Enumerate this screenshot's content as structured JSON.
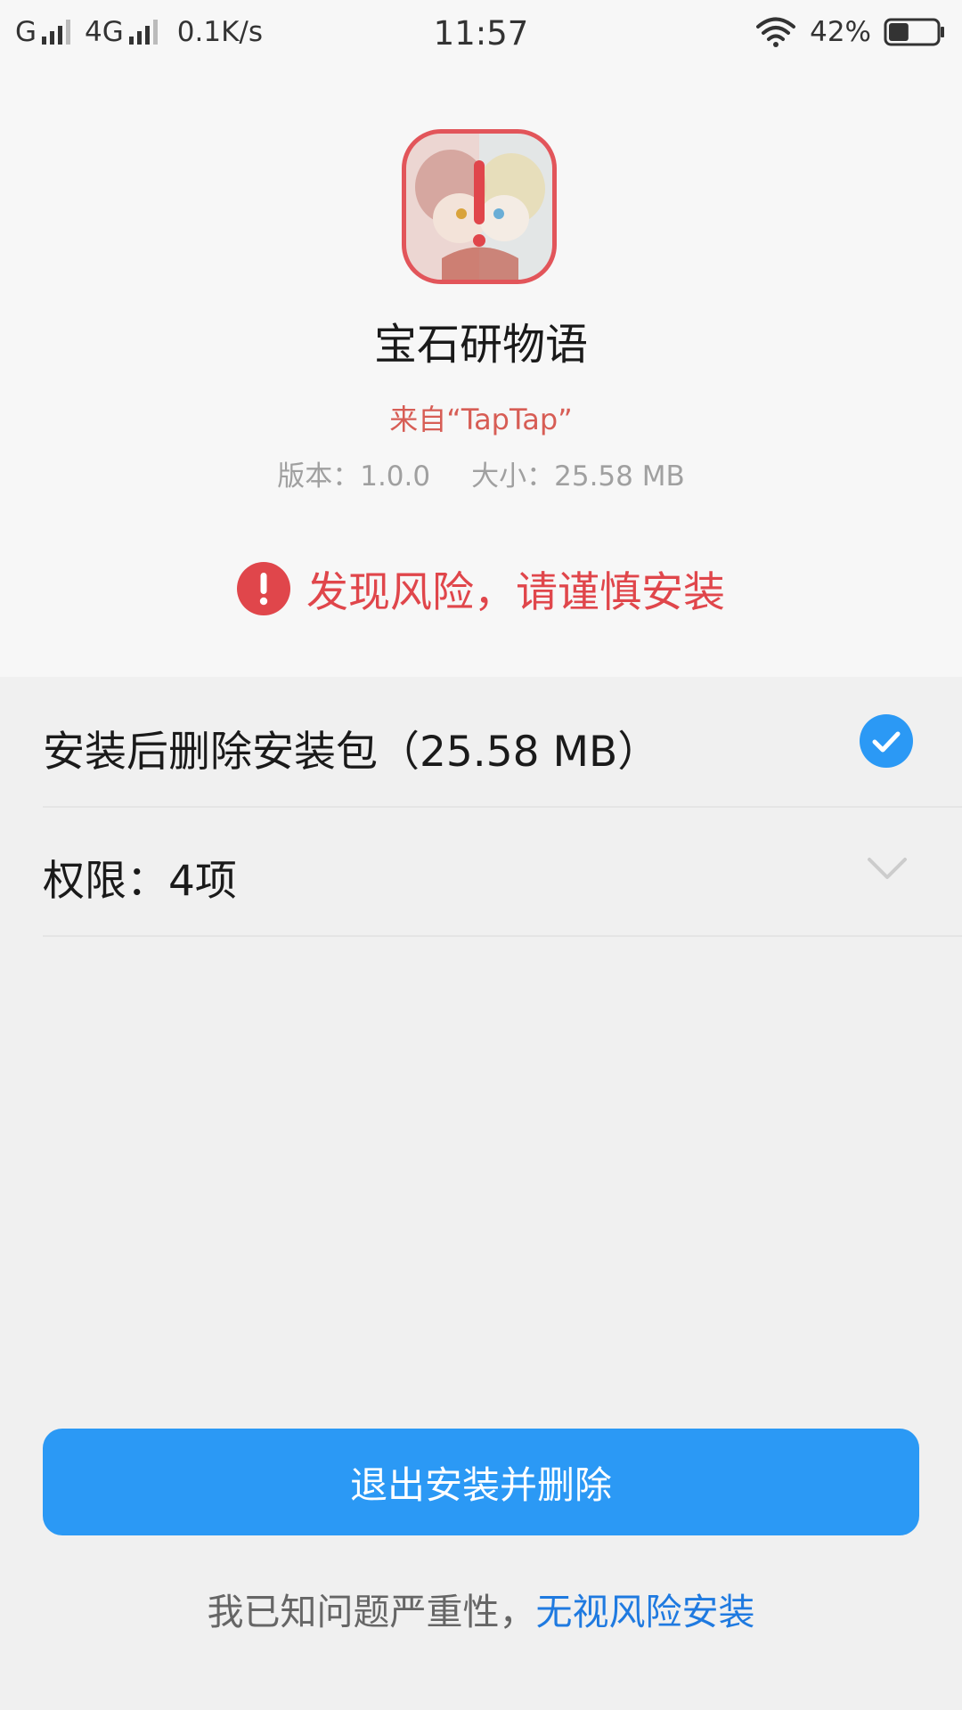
{
  "status_bar": {
    "carrier1": "G",
    "carrier2": "4G",
    "net_speed": "0.1K/s",
    "time": "11:57",
    "battery_text": "42%",
    "battery_level": 0.42,
    "icons": [
      "signal-icon",
      "wifi-icon",
      "battery-icon"
    ]
  },
  "app": {
    "name": "宝石研物语",
    "source": "来自“TapTap”",
    "version": "版本：1.0.0",
    "size": "大小：25.58 MB",
    "icon": "app-icon-warning"
  },
  "risk": {
    "icon": "exclamation-circle-icon",
    "text": "发现风险，请谨慎安装"
  },
  "options": {
    "delete_package_label": "安装后删除安装包（25.58 MB）",
    "delete_package_checked": true,
    "permissions_label": "权限：4项"
  },
  "actions": {
    "exit_button": "退出安装并删除",
    "footer_prefix": "我已知问题严重性，",
    "footer_link": "无视风险安装"
  },
  "colors": {
    "accent": "#2b99f5",
    "danger": "#e0464b",
    "link": "#1f7ae0",
    "background": "#f0f0f0"
  }
}
